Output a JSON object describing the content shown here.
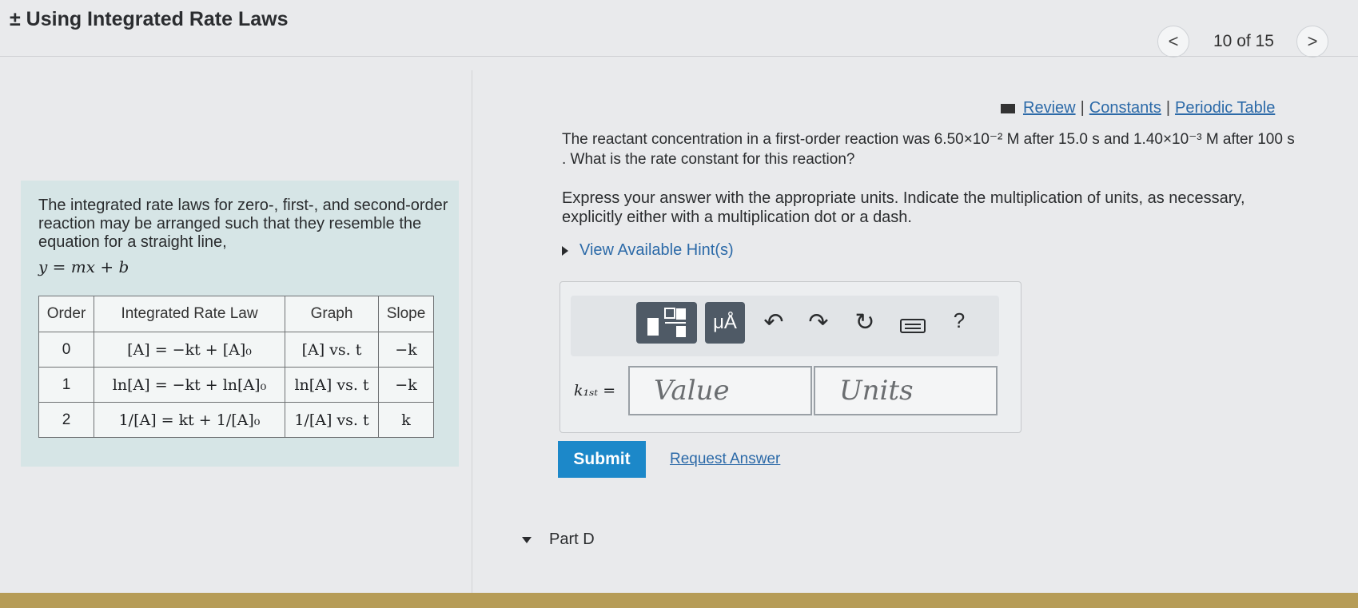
{
  "header": {
    "title": "± Using Integrated Rate Laws",
    "prev_icon": "<",
    "next_icon": ">",
    "page_counter": "10 of 15"
  },
  "intro": {
    "text": "The integrated rate laws for zero-, first-, and second-order reaction may be arranged such that they resemble the equation for a straight line,",
    "equation": "y = mx + b"
  },
  "rate_table": {
    "headers": [
      "Order",
      "Integrated Rate Law",
      "Graph",
      "Slope"
    ],
    "rows": [
      {
        "order": "0",
        "law": "[A] = −kt + [A]₀",
        "graph": "[A] vs. t",
        "slope": "−k"
      },
      {
        "order": "1",
        "law": "ln[A] = −kt + ln[A]₀",
        "graph": "ln[A] vs. t",
        "slope": "−k"
      },
      {
        "order": "2",
        "law": "1/[A] = kt + 1/[A]₀",
        "graph": "1/[A] vs. t",
        "slope": "k"
      }
    ]
  },
  "links": {
    "review": "Review",
    "constants": "Constants",
    "periodic_table": "Periodic Table",
    "separator": "|"
  },
  "question": {
    "text": "The reactant concentration in a first-order reaction was 6.50×10⁻² M after 15.0 s and 1.40×10⁻³ M after 100 s . What is the rate constant for this reaction?"
  },
  "instructions": "Express your answer with the appropriate units. Indicate the multiplication of units, as necessary, explicitly either with a multiplication dot or a dash.",
  "hints_label": "View Available Hint(s)",
  "toolbar": {
    "units_button": "μÅ",
    "help_label": "?"
  },
  "answer": {
    "label": "k₁ₛₜ =",
    "value_placeholder": "Value",
    "units_placeholder": "Units"
  },
  "submit_label": "Submit",
  "request_answer_label": "Request Answer",
  "part_d_label": "Part D",
  "colors": {
    "link": "#2c6aa8",
    "submit_bg": "#1c88c9",
    "intro_bg": "#d6e5e6"
  }
}
